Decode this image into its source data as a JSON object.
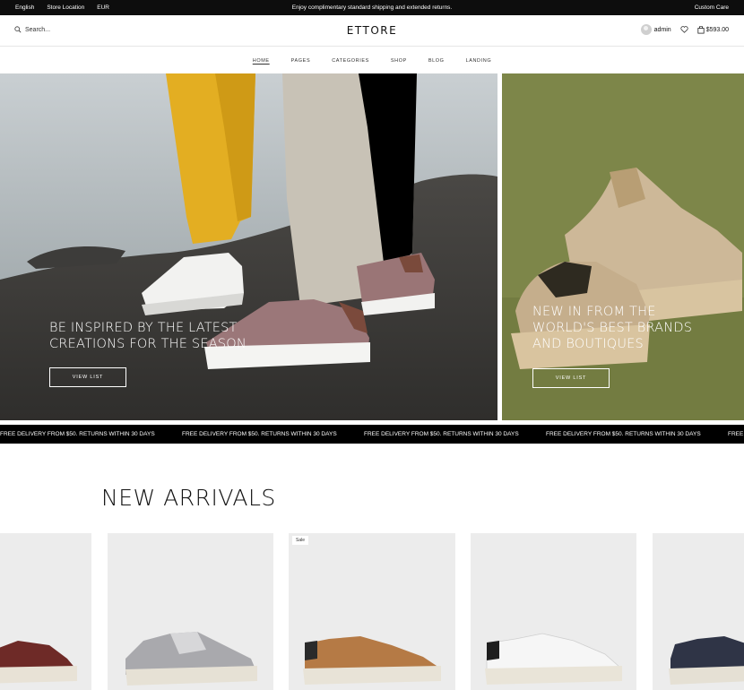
{
  "topbar": {
    "language": "English",
    "store_location": "Store Location",
    "currency": "EUR",
    "announcement": "Enjoy complimentary standard shipping and extended returns.",
    "custom_care": "Custom Care"
  },
  "header": {
    "search_placeholder": "Search...",
    "logo": "ETTORE",
    "user": "admin",
    "cart_total": "$593.00",
    "icons": [
      "search-icon",
      "user-avatar-icon",
      "heart-icon",
      "bag-icon"
    ]
  },
  "nav": {
    "items": [
      "HOME",
      "PAGES",
      "CATEGORIES",
      "SHOP",
      "BLOG",
      "LANDING"
    ],
    "active": "HOME"
  },
  "hero": {
    "left": {
      "line1": "BE INSPIRED BY THE LATEST",
      "line2": "CREATIONS FOR THE SEASON",
      "button": "VIEW LIST"
    },
    "right": {
      "line1": "NEW IN FROM THE",
      "line2": "WORLD'S BEST BRANDS",
      "line3": "AND BOUTIQUES",
      "button": "VIEW LIST"
    }
  },
  "marquee": {
    "text": "FREE DELIVERY FROM $50. RETURNS WITHIN 30 DAYS"
  },
  "new_arrivals": {
    "title": "NEW ARRIVALS",
    "badge": "Sale",
    "products": [
      {
        "image": "burgundy-leather-sneaker"
      },
      {
        "image": "silver-metallic-sneaker"
      },
      {
        "image": "tan-suede-sneaker"
      },
      {
        "image": "white-leather-sneaker"
      },
      {
        "image": "navy-suede-sneaker"
      }
    ]
  },
  "colors": {
    "topbar_bg": "#0d0d0d",
    "marquee_bg": "#000000",
    "card_bg": "#ececec",
    "right_hero_bg": "#7b8447"
  }
}
